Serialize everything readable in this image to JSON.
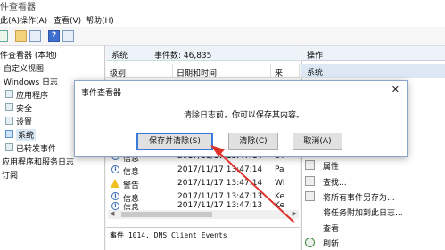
{
  "window": {
    "title": "件查看器"
  },
  "menu": {
    "items": [
      "此(A)",
      "操作(A)",
      "查看(V)",
      "帮助(H)"
    ]
  },
  "tree": {
    "items": [
      "件查看器 (本地)",
      "自定义视图",
      "Windows 日志",
      "应用程序",
      "安全",
      "设置",
      "系统",
      "已转发事件",
      "应用程序和服务日志",
      "订阅"
    ]
  },
  "list": {
    "header_name": "系统",
    "header_count": "事件数: 46,835",
    "columns": [
      "级别",
      "日期和时间",
      "来"
    ],
    "rows": [
      {
        "level": "信息",
        "datetime": "2017/11/17 13:47:14",
        "source": "BT",
        "type": "info"
      },
      {
        "level": "信息",
        "datetime": "2017/11/17 13:47:14",
        "source": "Pa",
        "type": "info"
      },
      {
        "level": "警告",
        "datetime": "2017/11/17 13:47:14",
        "source": "Wl",
        "type": "warning"
      },
      {
        "level": "信息",
        "datetime": "2017/11/17 13:47:13",
        "source": "Ke",
        "type": "info"
      },
      {
        "level": "信息",
        "datetime": "2017/11/17 13:47:13",
        "source": "Ke",
        "type": "info"
      }
    ],
    "detail_title": "事件 1014, DNS Client Events"
  },
  "actions": {
    "header": "操作",
    "section": "系统",
    "items": [
      "属性",
      "查找...",
      "将所有事件另存为...",
      "将任务附加到此日志...",
      "查看",
      "刷新"
    ]
  },
  "dialog": {
    "title": "事件查看器",
    "message": "清除日志前，你可以保存其内容。",
    "save_clear_label": "保存并清除(S)",
    "clear_label": "清除(C)",
    "cancel_label": "取消(A)",
    "close_glyph": "✕"
  },
  "glyphs": {
    "close": "✕",
    "scroll_left": "◀",
    "scroll_right": "▶",
    "help": "?",
    "info": "i"
  },
  "colors": {
    "accent": "#3b7ad9",
    "annotation_arrow": "#e0302a"
  }
}
